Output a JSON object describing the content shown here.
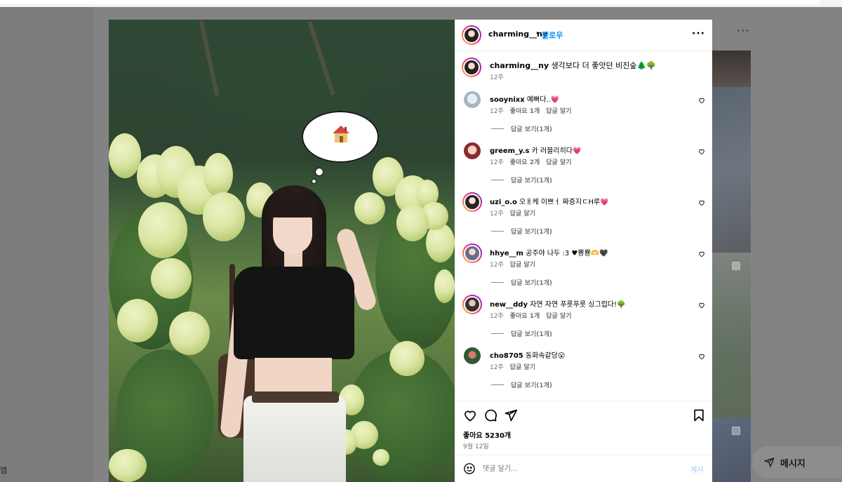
{
  "background": {
    "left_text": "앱",
    "dm_label": "메시지"
  },
  "post": {
    "author": "charming__ny",
    "separator": "•",
    "follow_label": "팔로우",
    "caption_user": "charming__ny",
    "caption_text": "생각보다 더 좋앗던 비진숲🌲🌳",
    "caption_time": "12주",
    "likes": "좋아요 5230개",
    "date": "9월 12일",
    "comment_placeholder": "댓글 달기...",
    "post_label": "게시"
  },
  "comments": [
    {
      "user": "sooynixx",
      "text": "예뻐다..💗",
      "time": "12주",
      "likes": "좋아요 1개",
      "reply_label": "답글 달기",
      "view_replies": "답글 보기(1개)"
    },
    {
      "user": "greem_y.s",
      "text": "카 러블리히다💗",
      "time": "12주",
      "likes": "좋아요 2개",
      "reply_label": "답글 달기",
      "view_replies": "답글 보기(1개)"
    },
    {
      "user": "uzi_o.o",
      "text": "오ㅐ케 이쁘ㅓ 짜증지ㄷH루💗",
      "time": "12주",
      "likes": "",
      "reply_label": "답글 달기",
      "view_replies": "답글 보기(1개)"
    },
    {
      "user": "hhye__m",
      "text": "공주야 나두 :3 ♥뿅뿅🫶🖤",
      "time": "12주",
      "likes": "",
      "reply_label": "답글 달기",
      "view_replies": "답글 보기(1개)"
    },
    {
      "user": "new__ddy",
      "text": "자연 자연 푸릇푸릇 싱그럽다!🌳",
      "time": "12주",
      "likes": "좋아요 1개",
      "reply_label": "답글 달기",
      "view_replies": "답글 보기(1개)"
    },
    {
      "user": "cho8705",
      "text": "동화속같당😮",
      "time": "12주",
      "likes": "",
      "reply_label": "답글 달기",
      "view_replies": "답글 보기(1개)"
    }
  ],
  "colors": {
    "accent": "#0095f6",
    "muted": "#737373",
    "overlay": "#838383"
  },
  "icons": [
    "more-icon",
    "heart-icon",
    "comment-icon",
    "share-icon",
    "bookmark-icon",
    "emoji-icon",
    "chevron-right-icon",
    "house-emoji-icon",
    "send-icon"
  ]
}
